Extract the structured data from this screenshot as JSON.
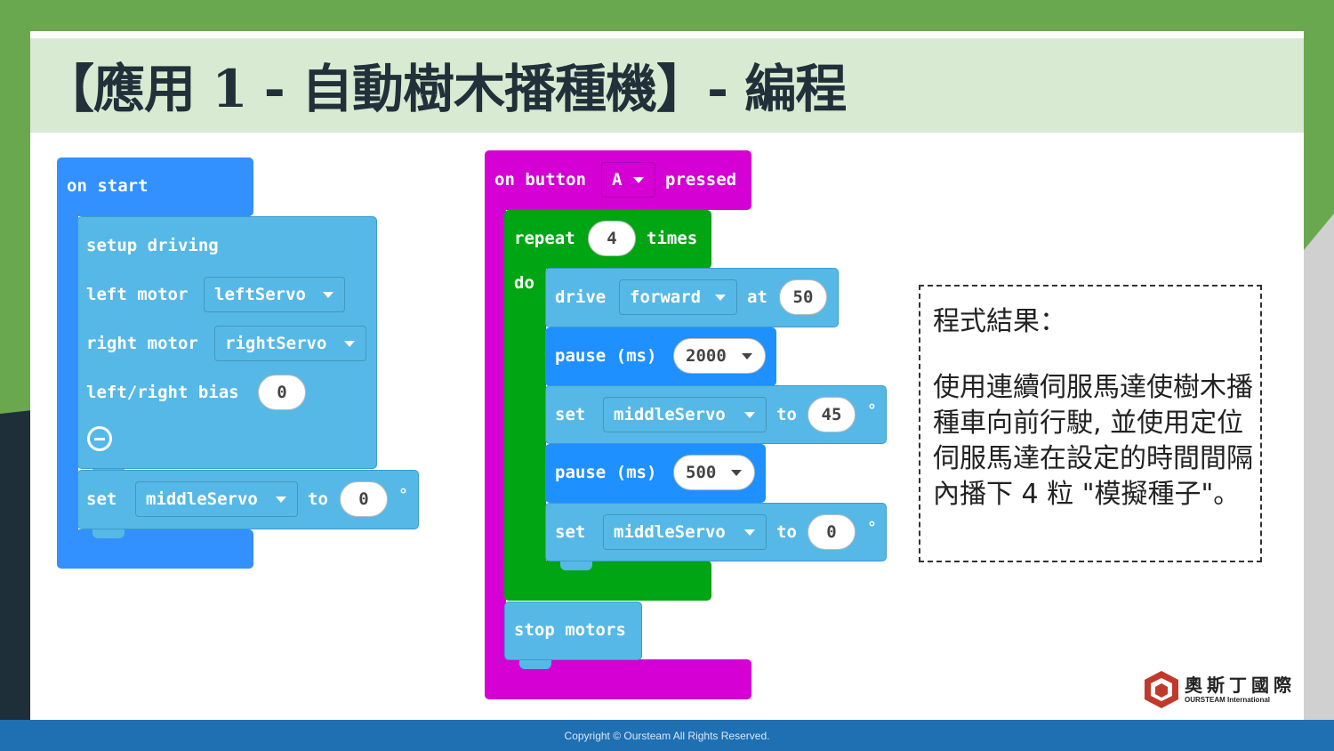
{
  "slide": {
    "title": "【應用 1 - 自動樹木播種機】- 編程",
    "footer": "Copyright © Oursteam All Rights Reserved."
  },
  "on_start": {
    "header": "on start",
    "setup_label": "setup driving",
    "left_motor_label": "left motor",
    "left_motor_value": "leftServo",
    "right_motor_label": "right motor",
    "right_motor_value": "rightServo",
    "bias_label": "left/right bias",
    "bias_value": "0",
    "set_label": "set",
    "set_servo": "middleServo",
    "to_label": "to",
    "set_value": "0",
    "degree": "°"
  },
  "on_button": {
    "on_label": "on button",
    "button": "A",
    "pressed_label": "pressed",
    "repeat_label": "repeat",
    "repeat_count": "4",
    "times_label": "times",
    "do_label": "do",
    "drive_label": "drive",
    "drive_dir": "forward",
    "at_label": "at",
    "drive_speed": "50",
    "pause_label": "pause (ms)",
    "pause1": "2000",
    "set_label": "set",
    "servo1": "middleServo",
    "to_label": "to",
    "servo1_value": "45",
    "pause2": "500",
    "servo2": "middleServo",
    "servo2_value": "0",
    "degree": "°",
    "stop_label": "stop motors"
  },
  "result": {
    "title": "程式結果：",
    "body": "使用連續伺服馬達使樹木播種車向前行駛, 並使用定位伺服馬達在設定的時間間隔內播下 4 粒 \"模擬種子\"。"
  },
  "logo": {
    "cn": "奧斯丁國際",
    "en": "OURSTEAM International"
  },
  "colors": {
    "event_blue": "#3290ff",
    "drive_light_blue": "#56b8e6",
    "event_magenta": "#d400d4",
    "loop_green": "#00a513",
    "pause_blue": "#1e90ff"
  }
}
